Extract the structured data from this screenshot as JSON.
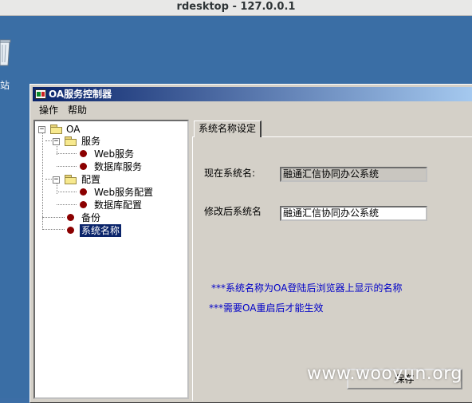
{
  "rdesktop": {
    "title": "rdesktop - 127.0.0.1"
  },
  "desktop": {
    "recycle_label": "站"
  },
  "window": {
    "title": "OA服务控制器",
    "menu": [
      "操作",
      "帮助"
    ]
  },
  "tree": {
    "root": "OA",
    "groups": [
      {
        "label": "服务",
        "children": [
          "Web服务",
          "数据库服务"
        ]
      },
      {
        "label": "配置",
        "children": [
          "Web服务配置",
          "数据库配置"
        ]
      }
    ],
    "leaves": [
      "备份",
      "系统名称"
    ]
  },
  "panel": {
    "tab_label": "系统名称设定",
    "current_label": "现在系统名:",
    "current_value": "融通汇信协同办公系统",
    "new_label": "修改后系统名",
    "new_value": "融通汇信协同办公系统",
    "note1": "***系统名称为OA登陆后浏览器上显示的名称",
    "note2": "***需要OA重启后才能生效",
    "save_label": "保存"
  },
  "watermark": "www.wooyun.org"
}
